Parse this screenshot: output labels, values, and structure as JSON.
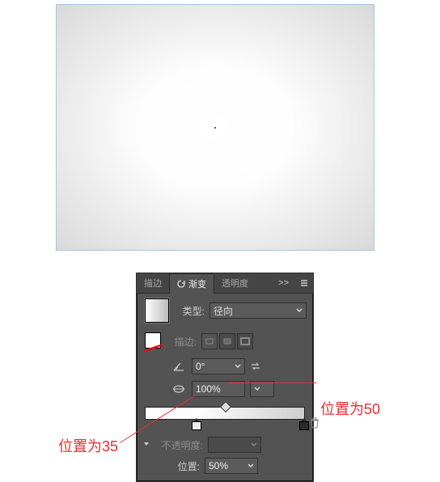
{
  "tabs": {
    "stroke": "描边",
    "gradient": "渐变",
    "transparency": "透明度"
  },
  "collapse_glyph": ">>",
  "menu_glyph": "≡",
  "typeRow": {
    "label": "类型:",
    "value": "径向"
  },
  "strokeRow": {
    "label": "描边:"
  },
  "angleRow": {
    "label_icon": "⊿",
    "value": "0°"
  },
  "aspectRow": {
    "label_icon": "⬯",
    "value": "100%"
  },
  "opacityRow": {
    "label": "不透明度:",
    "value": ""
  },
  "positionRow": {
    "label": "位置:",
    "value": "50%"
  },
  "slider": {
    "midpoint_pct": 50,
    "stops": [
      {
        "color": "#ffffff",
        "pos_pct": 35
      },
      {
        "color": "#cfcfcf",
        "pos_pct": 100
      }
    ]
  },
  "annotations": {
    "pos50": "位置为50",
    "pos35": "位置为35"
  }
}
